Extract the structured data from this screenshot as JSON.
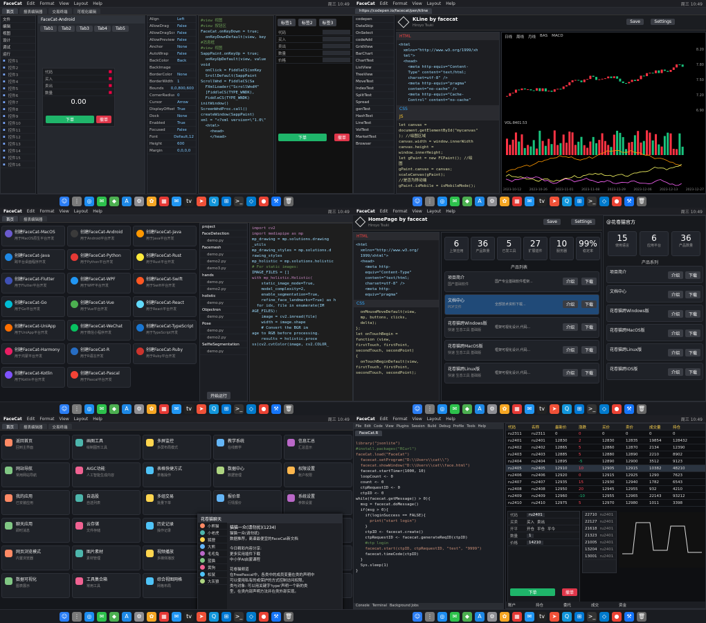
{
  "menubar": {
    "app": "FaceCat",
    "items": [
      "Edit",
      "Format",
      "View",
      "Layout",
      "Help"
    ],
    "clock": "周三 10:49"
  },
  "q1": {
    "tabs": [
      "首页",
      "报表编辑器",
      "交易终端",
      "可视化编辑"
    ],
    "nav": [
      "文件",
      "编辑",
      "视图",
      "设计",
      "调试",
      "运行"
    ],
    "form_label": "FaceCat-Android",
    "props": [
      [
        "Align",
        "Left"
      ],
      [
        "AllowDrag",
        "False"
      ],
      [
        "AllowDragScroll",
        "False"
      ],
      [
        "AllowPreviewsEvent",
        "False"
      ],
      [
        "Anchor",
        "None"
      ],
      [
        "AutoWrap",
        "False"
      ],
      [
        "BackColor",
        "Back"
      ],
      [
        "BackImage",
        ""
      ],
      [
        "BorderColor",
        "None"
      ],
      [
        "BorderWidth",
        "1"
      ],
      [
        "Bounds",
        "0,0,800,600"
      ],
      [
        "CornerRadius",
        "0"
      ],
      [
        "Cursor",
        "Arrow"
      ],
      [
        "DisplayOffset",
        "True"
      ],
      [
        "Dock",
        "None"
      ],
      [
        "Enabled",
        "True"
      ],
      [
        "Focused",
        "False"
      ],
      [
        "Font",
        "Default,12"
      ],
      [
        "Height",
        "600"
      ],
      [
        "Margin",
        "0,0,0,0"
      ]
    ],
    "buy": "下单",
    "sell": "撤单",
    "price": "0.00",
    "code": [
      "#view 视图",
      "#view 按钮区",
      "FaceCat.onKeyDown = true;",
      "  onKeyDownDefault(view, key",
      "",
      "#消息框",
      "#view 视图",
      "SappPaint.onKeyUp = true;",
      "  onKeyUpDefault(view, value",
      "",
      "void",
      "  onClick = FiddleCS(onKey",
      "  SrollDefault(SappPaint",
      "ScrollWnd = FiddleCS(Sa",
      "  FXmlLoader(\"ScrollWndH\"",
      "  [FiddleCS(TYPE_WNDK),",
      "  FiddleCS(TYPE_WNDK)",
      "initWindow()",
      "ScreenWndProc.call()",
      "createWindow(SappPaint)",
      "xml = \"<?xml version=\\\"1.0\\\"",
      "  <html>",
      "    <head>",
      "    </head>"
    ],
    "order_labels": [
      "代码",
      "买入",
      "卖出",
      "数量",
      "价格"
    ],
    "order_btn": "下单"
  },
  "q2": {
    "url": "https://codepen.io/facecat/pen/kline",
    "title": "KLine by facecat",
    "subtitle": "Hiroyo Tsuki",
    "buttons": [
      "Save",
      "Settings"
    ],
    "html_code": [
      "<html",
      "  xmlns=\"http://www.w3.org/1999/xh",
      "  tml\">",
      "  <head>",
      "    <meta http-equiv=\"Content-",
      "    Type\" content=\"text/html;",
      "    charset=utf-8\" />",
      "    <meta http-equiv=\"pragma\"",
      "    content=\"no-cache\" />",
      "    <meta http-equiv=\"Cache-",
      "    Control\" content=\"no-cache\""
    ],
    "js_code": [
      "let canvas =",
      "document.getElementById(\"mycanvas\"",
      "); //绘图区域",
      "canvas.width = window.innerWidth",
      "canvas.height =",
      "window.innerHeight;",
      "let gPaint = new FCPaint(); //绘",
      "图",
      "gPaint.canvas = canvas;",
      "scaleCanvas(gPaint);",
      "//是否为移动端",
      "gPaint.isMobile = isMobileMode();"
    ],
    "chart_tabs": [
      "日线",
      "周线",
      "月线",
      "BAS",
      "MACD"
    ],
    "vol_label": "VOL:8401.53",
    "y_ticks": [
      "8.20",
      "7.80",
      "7.50",
      "7.20",
      "6.90"
    ],
    "x_ticks": [
      "2023-10-12",
      "2023-10-26",
      "2023-11-01",
      "2023-11-08",
      "2023-11-29",
      "2023-12-06",
      "2023-12-13",
      "2023-12-27"
    ],
    "list": [
      "codepen",
      "DataSkip",
      "OnSelect",
      "codeAdd",
      "GridView",
      "BarChart",
      "ChartTest",
      "ListView",
      "TreeView",
      "MoveTest",
      "IndexTest",
      "SplitTest",
      "Spread",
      "genTest",
      "HashTest",
      "LineTest",
      "VolTest",
      "MarketTest",
      "Browser"
    ],
    "panel_labels": [
      "HTML",
      "CSS",
      "JS"
    ]
  },
  "q3": {
    "cards": [
      [
        "创建FaceCat-MacOS",
        "用于MacOS原生平台开发"
      ],
      [
        "创建FaceCat-Android",
        "用于Android平台开发"
      ],
      [
        "创建FaceCat-Java",
        "用于Java平台开发"
      ],
      [
        "创建FaceCat-Java",
        "跨平台桌面程序开发"
      ],
      [
        "创建FaceCat-Python",
        "用于Python平台开发"
      ],
      [
        "创建FaceCat-Rust",
        "用于Rust平台开发"
      ],
      [
        "创建FaceCat-Flutter",
        "用于Flutter平台开发"
      ],
      [
        "创建FaceCat-WPF",
        "用于WPF平台开发"
      ],
      [
        "创建FaceCat-Swift",
        "用于Swift平台开发"
      ],
      [
        "创建FaceCat-Go",
        "用于Go平台开发"
      ],
      [
        "创建FaceCat-Vue",
        "用于Vue平台开发"
      ],
      [
        "创建FaceCat-React",
        "用于React平台开发"
      ],
      [
        "创建FaceCat-UniApp",
        "用于UniApp平台开发"
      ],
      [
        "创建FaceCat-WeChat",
        "用于微信小程序开发"
      ],
      [
        "创建FaceCat-TypeScript",
        "用于TypeScript开发"
      ],
      [
        "创建FaceCat-Harmony",
        "用于鸿蒙平台开发"
      ],
      [
        "创建FaceCat-R",
        "用于R语言开发"
      ],
      [
        "创建FaceCat-Ruby",
        "用于Ruby平台开发"
      ],
      [
        "创建FaceCat-Kotlin",
        "用于Kotlin平台开发"
      ],
      [
        "创建FaceCat-Pascal",
        "用于Pascal平台开发"
      ]
    ],
    "tree": [
      "project",
      "FaceDetection",
      "demo.py",
      "Facemesh",
      "demo.py",
      "demo2.py",
      "demo3.py",
      "hands",
      "demo.py",
      "demo2.py",
      "holistic",
      "demo.py",
      "Objectron",
      "demo.py",
      "Pose",
      "demo.py",
      "demo2.py",
      "SelfieSegmentation",
      "demo.py"
    ],
    "tree_btn": "开始运行",
    "code": [
      "import cv2",
      "import mediapipe as mp",
      "mp_drawing = mp.solutions.drawing",
      "_utils",
      "mp_drawing_styles = mp.solutions.d",
      "rawing_styles",
      "mp_holistic = mp.solutions.holistic",
      "",
      "# For static images:",
      "IMAGE_FILES = []",
      "with mp_holistic.Holistic(",
      "    static_image_mode=True,",
      "    model_complexity=2,",
      "    enable_segmentation=True,",
      "    refine_face_landmarks=True) as h",
      "  for idx, file in enumerate(IM",
      "AGE_FILES):",
      "    image = cv2.imread(file)",
      "",
      "    width = image.shape",
      "    # Convert the BGR im",
      "age to RGB before processing.",
      "    results = holistic.proce",
      "ss(cv2.cvtColor(image, cv2.COLOR_"
    ]
  },
  "q4": {
    "title": "HomePage by facecat",
    "subtitle": "Hiroyo Tsuki",
    "buttons": [
      "Save",
      "Settings"
    ],
    "html_code": [
      "<html",
      "  xmlns=\"http://www.w3.org/",
      "  1999/xhtml\">",
      "  <head>",
      "    <meta http-",
      "    equiv=\"Content-Type\"",
      "    content=\"text/html;",
      "    charset=utf-8\" />",
      "    <meta http-",
      "    equiv=\"pragma\""
    ],
    "js_code": [
      "  onMouseMoveDefault(view,",
      "  mp, buttons, clicks,",
      "  delta);",
      "};",
      "let onTouchBegin =",
      "function (view,",
      "firstTouch, firstPoint,",
      "secondTouch, secondPoint)",
      "{",
      "  onTouchBeginDefault(view,",
      "firstTouch, firstPoint,",
      "secondTouch, secondPoint);"
    ],
    "stats": [
      [
        "6",
        "上架应用"
      ],
      [
        "36",
        "产品数量"
      ],
      [
        "5",
        "已发工具"
      ],
      [
        "27",
        "扩展插件"
      ],
      [
        "10",
        "服务器"
      ],
      [
        "99%",
        "稳定率"
      ]
    ],
    "section": "产品列表",
    "products": [
      [
        "项目简介",
        "国产基础软件",
        "国产专业基础软件框架..."
      ],
      [
        "文档中心",
        "PDF文件",
        "全部技术资料下载..."
      ],
      [
        "花卷猫跨Windows版",
        "快速 生态工具 基础版",
        "框架可视化设计,代码..."
      ],
      [
        "花卷猫跨MacOS版",
        "快速 生态工具 基础版",
        "框架可视化设计,代码..."
      ],
      [
        "花卷猫跨Linux版",
        "快速 生态工具 基础版",
        "框架可视化设计,代码..."
      ]
    ],
    "side_title": "@花卷猫官方",
    "side_stats": [
      [
        "15",
        "使用语言"
      ],
      [
        "6",
        "应用平台"
      ],
      [
        "36",
        "产品数量"
      ]
    ],
    "side_section": "产品系列",
    "side_items": [
      "项目简介",
      "文档中心",
      "花卷猫跨Windows版",
      "花卷猫跨MacOS版",
      "花卷猫跨Linux版",
      "花卷猫跨iOS版"
    ],
    "side_btns": [
      "介绍",
      "下载"
    ]
  },
  "q5": {
    "tabs": [
      "首页",
      "报表编辑器",
      "交易终端"
    ],
    "tiles": [
      [
        "返回首页",
        "回到主界面"
      ],
      [
        "画图工具",
        "绘制图形工具"
      ],
      [
        "多屏监控",
        "多屏布局模式"
      ],
      [
        "教学系统",
        "在线教学"
      ],
      [
        "信息汇总",
        "汇总显示"
      ],
      [
        "网站导航",
        "常用网站导航"
      ],
      [
        "AIGC功能",
        "人工智能生成内容"
      ],
      [
        "表格快捷方式",
        "表格操作"
      ],
      [
        "数据中心",
        "数据管理"
      ],
      [
        "权限设置",
        "账户权限"
      ],
      [
        "我的应用",
        "已安装应用"
      ],
      [
        "自选股",
        "自选列表"
      ],
      [
        "多组交易",
        "批量下单"
      ],
      [
        "报价单",
        "行情报价"
      ],
      [
        "系统设置",
        "参数设置"
      ],
      [
        "聊天应用",
        "即时消息"
      ],
      [
        "云存储",
        "文件存储"
      ],
      [
        "历史记录",
        "操作记录"
      ],
      [
        "插件管理",
        "扩展插件"
      ],
      [
        "帮助中心",
        "使用说明"
      ],
      [
        "网页浏览模式",
        "内置浏览器"
      ],
      [
        "图片素材",
        "素材管理"
      ],
      [
        "视频播放",
        "多媒体播放"
      ],
      [
        "日志查看",
        "系统日志"
      ],
      [
        "关于",
        "版本信息"
      ],
      [
        "数据可视化",
        "图表展示"
      ],
      [
        "工具集合箱",
        "常用工具"
      ],
      [
        "综合视图网格",
        "网格布局"
      ],
      [
        "快捷键",
        "按键说明"
      ],
      [
        "退出",
        "关闭程序"
      ]
    ],
    "chat_title": "花卷猫聊天",
    "chat_group": "猫猫一众(请勿扰)(1234)",
    "chat_users": [
      "小熊猫",
      "小老虎",
      "狐狸",
      "大熊",
      "毛毛兔",
      "蓝猫",
      "黄狗",
      "松鼠",
      "大灰狼"
    ],
    "chat_lines": [
      "猫猫一众(请勿扰)",
      "数据推荐，离谱最便宜的FaceCat新文档",
      "",
      "今日精彩内容分享:",
      "更多实用插件下载",
      "中小学AI启蒙课程",
      "",
      "花卷猫频道",
      "在FreePascal中，各类中的成员变量在类的声明中",
      "可以使用私有的或保护的方式控制访问权限，",
      "类与对象: 可以用关键字'type'声明一个新的类",
      "型，在类内部声明方法并在类外部实现。"
    ]
  },
  "q6": {
    "editor_menu": [
      "File",
      "Edit",
      "Code",
      "View",
      "Plugins",
      "Session",
      "Build",
      "Debug",
      "Profile",
      "Tools",
      "Help"
    ],
    "code": [
      "library(\"jsonlite\")",
      "#install.packages(\"RCurl\")",
      "faceCat.load(\"FaceCat\")",
      "",
      "  facecat.setProgram(\"D:\\\\Users\\\\cat\\\\\")",
      "  facecat.showWindow(\"D:\\\\Users\\\\cat\\\\face.html\")",
      "  facecat.startTimer(1000, 10)",
      "  loopCount <- 0",
      "  count <- 0",
      "  ctpRequestID <- 0",
      "  ctpID <- 0",
      "while(facecat.getMessage() > 0){",
      "  msg = facecat.doMessage()",
      "  if(msg > 0){",
      "    if(loginSuccess == FALSE){",
      "      print(\"start login\")",
      "    }",
      "    ctpID <- facecat.create()",
      "",
      "    ctpRequestID <- facecat.generateReqID(ctpID)",
      "",
      "    #ctp login",
      "    facecat.start(ctpID, ctpRequestID, \"test\", \"9999\")",
      "    facecat.timeCode(ctpID)",
      "  }",
      "  Sys.sleep(1)",
      "}"
    ],
    "code_tabs": [
      "Console",
      "Terminal",
      "Background Jobs"
    ],
    "code_name": "FaceCat.R",
    "table_head": [
      "代码",
      "名称",
      "最新价",
      "涨跌",
      "买价",
      "卖价",
      "成交量",
      "持仓"
    ],
    "table": [
      [
        "ru2311",
        "ru2311",
        "0",
        "0",
        "0",
        "0",
        "0",
        "0"
      ],
      [
        "ru2401",
        "ru2401",
        "12830",
        "2",
        "12830",
        "12835",
        "19854",
        "128432"
      ],
      [
        "ru2402",
        "ru2402",
        "12865",
        "5",
        "12860",
        "12870",
        "2134",
        "12390"
      ],
      [
        "ru2403",
        "ru2403",
        "12885",
        "5",
        "12880",
        "12890",
        "2210",
        "8902"
      ],
      [
        "ru2404",
        "ru2404",
        "12895",
        "-5",
        "12890",
        "12900",
        "3512",
        "9123"
      ],
      [
        "ru2405",
        "ru2405",
        "12910",
        "10",
        "12905",
        "12915",
        "10382",
        "48210"
      ],
      [
        "ru2406",
        "ru2406",
        "12920",
        "0",
        "12915",
        "12925",
        "1290",
        "7623"
      ],
      [
        "ru2407",
        "ru2407",
        "12935",
        "15",
        "12930",
        "12940",
        "1782",
        "6543"
      ],
      [
        "ru2408",
        "ru2408",
        "12950",
        "20",
        "12945",
        "12955",
        "932",
        "4210"
      ],
      [
        "ru2409",
        "ru2409",
        "12960",
        "-10",
        "12955",
        "12965",
        "22143",
        "93212"
      ],
      [
        "ru2410",
        "ru2410",
        "12975",
        "5",
        "12970",
        "12980",
        "1011",
        "3398"
      ]
    ],
    "order_code": "ru2401",
    "order_price": "14210",
    "order_qty": "1",
    "order_labels": [
      "代码",
      "买卖",
      "开平",
      "数量",
      "价格"
    ],
    "order_opts": [
      "买入",
      "卖出",
      "开仓",
      "平仓",
      "平今"
    ],
    "buy": "下单",
    "cancel": "撤单",
    "depth": [
      [
        "22710",
        "ru2401"
      ],
      [
        "22127",
        "ru2401"
      ],
      [
        "21618",
        "ru2401"
      ],
      [
        "21323",
        "ru2401"
      ],
      [
        "21005",
        "ru2401"
      ],
      [
        "13204",
        "ru2401"
      ],
      [
        "13001",
        "ru2401"
      ]
    ],
    "bottom": [
      "账户",
      "持仓",
      "委托",
      "成交",
      "资金"
    ]
  },
  "dock_icons": [
    "finder-icon",
    "launchpad-icon",
    "safari-icon",
    "wechat-icon",
    "maps-icon",
    "appstore-icon",
    "settings-icon",
    "photos-icon",
    "calendar-icon",
    "mail-icon",
    "tv-icon",
    "swift-icon",
    "qq-icon",
    "windows-icon",
    "terminal-icon",
    "vscode-icon",
    "chrome-icon",
    "xcode-icon",
    "trash-icon"
  ]
}
